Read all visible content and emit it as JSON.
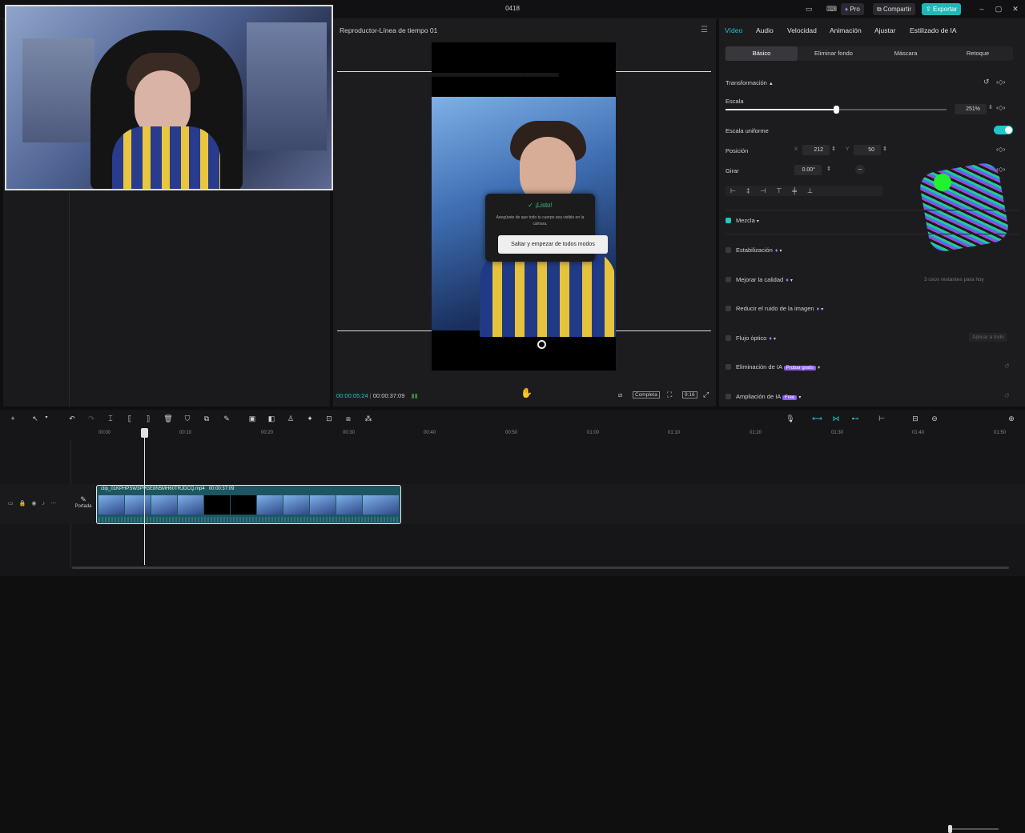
{
  "window": {
    "title": "0418",
    "pro_label": "Pro",
    "share_label": "Compartir",
    "export_label": "Exportar"
  },
  "player": {
    "title": "Reproductor-Línea de tiempo 01",
    "dialog_title": "¡Listo!",
    "dialog_message": "Asegúrate de que todo tu cuerpo sea visible en la cámara.",
    "dialog_button": "Saltar y empezar de todos modos",
    "current_time": "00:00:05:24",
    "total_time": "00:00:37:09",
    "complete_label": "Completa",
    "ratio_label": "9:16"
  },
  "props": {
    "tabs": [
      "Vídeo",
      "Audio",
      "Velocidad",
      "Animación",
      "Ajustar",
      "Estilizado de IA"
    ],
    "subtabs": [
      "Básico",
      "Eliminar fondo",
      "Máscara",
      "Retoque"
    ],
    "transform_label": "Transformación",
    "scale_label": "Escala",
    "scale_value": "251%",
    "scale_fraction": 0.5,
    "uniform_scale_label": "Escala uniforme",
    "position_label": "Posición",
    "pos_x_label": "X",
    "pos_x": "212",
    "pos_y_label": "Y",
    "pos_y": "50",
    "rotate_label": "Girar",
    "rotate_value": "0.00°",
    "rotate_reset": "–",
    "blend_label": "Mezcla",
    "stabilization_label": "Estabilización",
    "enhance_label": "Mejorar la calidad",
    "enhance_note": "3 usos restantes para hoy",
    "denoise_label": "Reducir el ruido de la imagen",
    "optical_flow_label": "Flujo óptico",
    "apply_all_label": "Aplicar a todo",
    "ai_removal_label": "Eliminación de IA",
    "ai_removal_badge": "Probar gratis",
    "ai_upscale_label": "Ampliación de IA",
    "ai_upscale_badge": "Free"
  },
  "timeline": {
    "ruler": [
      "00:00",
      "00:10",
      "00:20",
      "00:30",
      "00:40",
      "00:50",
      "01:00",
      "01:10",
      "01:20",
      "01:30",
      "01:40",
      "01:50"
    ],
    "clip_name": "clip_01KPHPSW3PVGE8N5MH60TRJDCQ.mp4",
    "clip_duration": "00:00:37:09",
    "cover_label": "Portada"
  },
  "colors": {
    "accent": "#1fc7c7",
    "export_bg": "#1fb8b8",
    "badge_purple": "#8b5cf6",
    "clip_bg": "#1d5660"
  }
}
